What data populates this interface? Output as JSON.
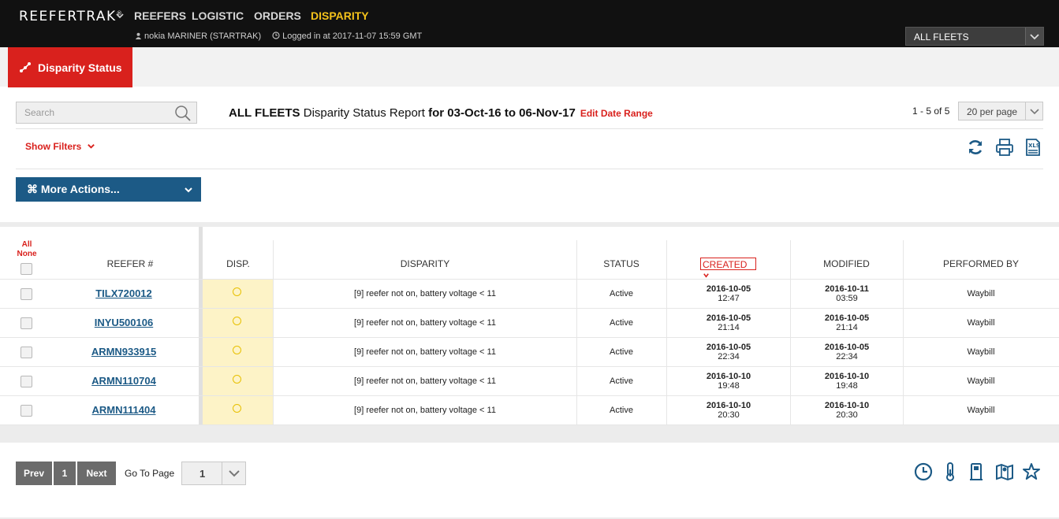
{
  "app": {
    "brand": "REEFERTRAK",
    "brand_mark": "®",
    "nav": [
      {
        "label": "REEFERS",
        "active": false
      },
      {
        "label": "LOGISTIC",
        "active": false
      },
      {
        "label": "ORDERS",
        "active": false
      },
      {
        "label": "DISPARITY",
        "active": true
      }
    ],
    "user": "nokia MARINER (STARTRAK)",
    "login": "Logged in at 2017-11-07 15:59 GMT",
    "fleet_selected": "ALL FLEETS"
  },
  "page": {
    "tab_label": "Disparity Status",
    "search_placeholder": "Search",
    "title_fleet": "ALL FLEETS",
    "title_report": " Disparity Status Report ",
    "title_range": "for 03-Oct-16 to 06-Nov-17",
    "edit_range": "Edit Date Range",
    "count": "1 - 5 of 5",
    "per_page": "20 per page",
    "show_filters": "Show Filters",
    "more_actions": "⌘ More Actions..."
  },
  "table": {
    "all": "All",
    "none": "None",
    "columns": {
      "reefer": "REEFER #",
      "disp": "DISP.",
      "disparity": "DISPARITY",
      "status": "STATUS",
      "created": "CREATED",
      "modified": "MODIFIED",
      "performed_by": "PERFORMED BY"
    },
    "rows": [
      {
        "reefer": "TILX720012",
        "disparity": "[9] reefer not on, battery voltage < 11",
        "status": "Active",
        "created_date": "2016-10-05",
        "created_time": "12:47",
        "modified_date": "2016-10-11",
        "modified_time": "03:59",
        "performed_by": "Waybill"
      },
      {
        "reefer": "INYU500106",
        "disparity": "[9] reefer not on, battery voltage < 11",
        "status": "Active",
        "created_date": "2016-10-05",
        "created_time": "21:14",
        "modified_date": "2016-10-05",
        "modified_time": "21:14",
        "performed_by": "Waybill"
      },
      {
        "reefer": "ARMN933915",
        "disparity": "[9] reefer not on, battery voltage < 11",
        "status": "Active",
        "created_date": "2016-10-05",
        "created_time": "22:34",
        "modified_date": "2016-10-05",
        "modified_time": "22:34",
        "performed_by": "Waybill"
      },
      {
        "reefer": "ARMN110704",
        "disparity": "[9] reefer not on, battery voltage < 11",
        "status": "Active",
        "created_date": "2016-10-10",
        "created_time": "19:48",
        "modified_date": "2016-10-10",
        "modified_time": "19:48",
        "performed_by": "Waybill"
      },
      {
        "reefer": "ARMN111404",
        "disparity": "[9] reefer not on, battery voltage < 11",
        "status": "Active",
        "created_date": "2016-10-10",
        "created_time": "20:30",
        "modified_date": "2016-10-10",
        "modified_time": "20:30",
        "performed_by": "Waybill"
      }
    ]
  },
  "pager": {
    "prev": "Prev",
    "current": "1",
    "next": "Next",
    "goto_label": "Go To Page",
    "goto_value": "1"
  },
  "icons": {
    "refresh": "refresh-icon",
    "print": "print-icon",
    "xls": "xls-export-icon",
    "clock": "clock-icon",
    "thermometer": "thermometer-icon",
    "fuel": "fuel-icon",
    "map": "map-icon",
    "star": "star-icon"
  },
  "colors": {
    "brand_red": "#d9211d",
    "nav_active": "#f4c21b",
    "primary_blue": "#1c5a86",
    "disp_highlight": "#fdf3c7"
  }
}
